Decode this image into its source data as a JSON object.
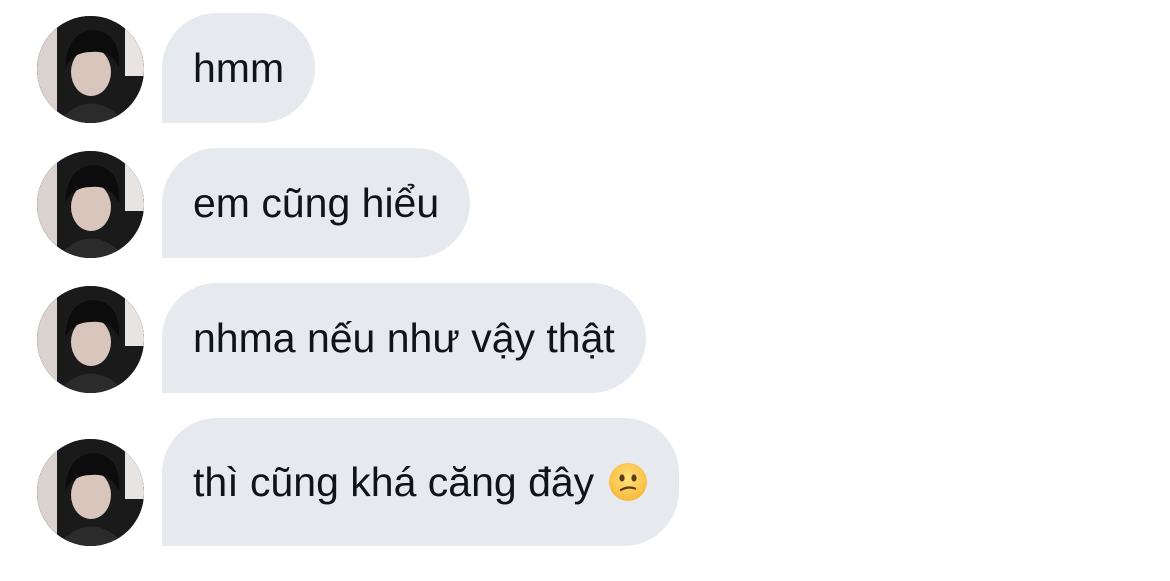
{
  "conversation": {
    "messages": [
      {
        "text": "hmm"
      },
      {
        "text": "em cũng hiểu"
      },
      {
        "text": "nhma nếu như vậy thật"
      },
      {
        "text": "thì cũng khá căng đây",
        "emoji": "confused-face-icon"
      }
    ]
  },
  "colors": {
    "bubble_bg": "#e6eaef",
    "text": "#0f1419",
    "background": "#ffffff"
  }
}
